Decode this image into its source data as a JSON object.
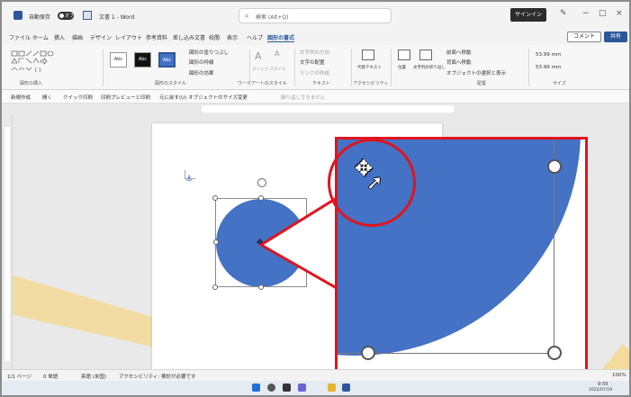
{
  "window": {
    "autosave_label": "自動保存",
    "autosave_state": "オフ",
    "doc_title": "文書 1 - Word",
    "search_placeholder": "検索 (Alt+Q)",
    "signin_label": "サインイン",
    "minimize": "−",
    "maximize": "□",
    "close": "×"
  },
  "menu": {
    "items": [
      "ファイル",
      "ホーム",
      "挿入",
      "描画",
      "デザイン",
      "レイアウト",
      "参考資料",
      "差し込み文書",
      "校閲",
      "表示",
      "ヘルプ",
      "図形の書式"
    ],
    "comment_label": "コメント",
    "share_label": "共有"
  },
  "ribbon": {
    "groups": {
      "insert_shapes": "図形の挿入",
      "shape_styles": "図形のスタイル",
      "wordart_styles": "ワードアートのスタイル",
      "text": "テキスト",
      "accessibility": "アクセシビリティ",
      "arrange": "配置",
      "size": "サイズ"
    },
    "style_swatch_label": "Abc",
    "shape_fill": "図形の塗りつぶし",
    "shape_outline": "図形の枠線",
    "shape_effects": "図形の効果",
    "quick_styles": "クイック スタイル",
    "text_direction": "文字列の方向",
    "align_text": "文字の配置",
    "create_link": "リンクの作成",
    "alt_text": "代替テキスト",
    "position": "位置",
    "wrap_text": "文字列の折り返し",
    "bring_forward": "前面へ移動",
    "send_backward": "背面へ移動",
    "selection_pane": "オブジェクトの選択と表示",
    "height_value": "53.99 mm",
    "width_value": "53.99 mm"
  },
  "qat": {
    "items": [
      "新規作成",
      "開く",
      "クイック印刷",
      "印刷プレビューと印刷",
      "元に戻す(U) オブジェクトのサイズ変更"
    ],
    "disabled_item": "繰り返しできません"
  },
  "statusbar": {
    "page": "1/1 ページ",
    "words": "0 単語",
    "language": "英語 (米国)",
    "accessibility": "アクセシビリティ: 検討が必要です",
    "zoom": "100%"
  },
  "taskbar": {
    "time": "9:59",
    "date": "2022/07/19"
  },
  "colors": {
    "shape_fill": "#4472c4",
    "callout": "#e0141e",
    "accent": "#2b579a"
  }
}
